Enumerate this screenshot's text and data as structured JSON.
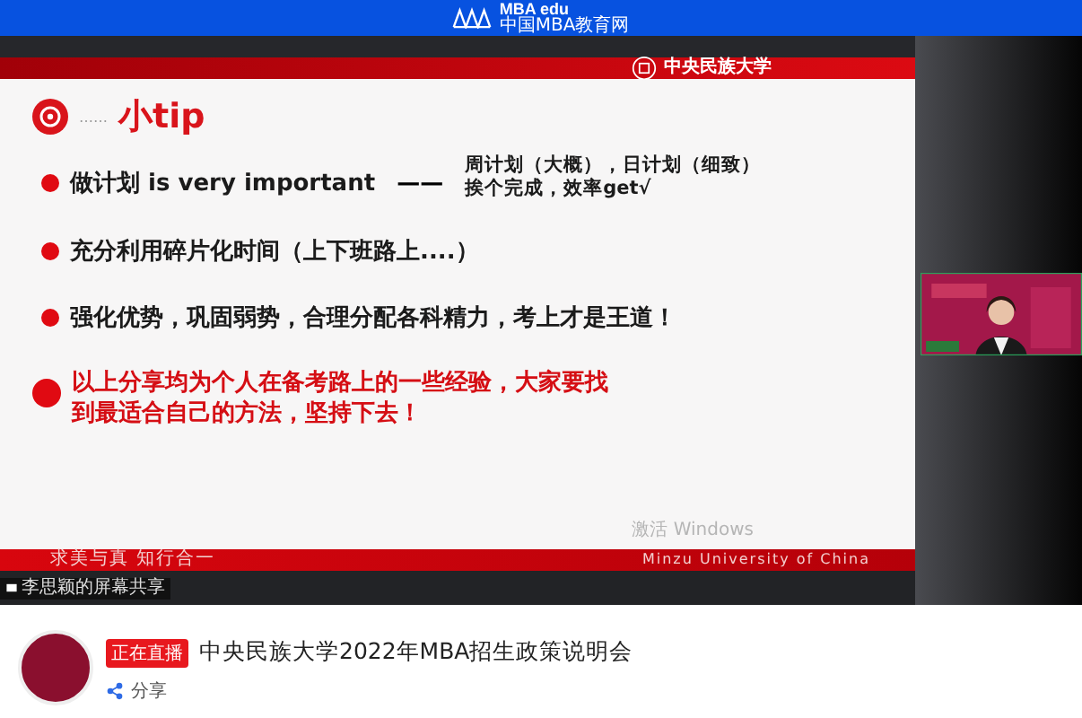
{
  "header": {
    "logo_text": "MBA edu",
    "logo_subtitle": "中国MBA教育网"
  },
  "slide": {
    "university_logo_text": "中央民族大学",
    "heading_dots": "……",
    "heading": "小tip",
    "bullets": [
      {
        "kind": "split",
        "text": "做计划 is very important",
        "dash": "——",
        "detail_lines": [
          "周计划（大概），日计划（细致）",
          "挨个完成，效率get√"
        ]
      },
      {
        "kind": "plain",
        "text": "充分利用碎片化时间（上下班路上....）"
      },
      {
        "kind": "plain",
        "text": "强化优势，巩固弱势，合理分配各科精力，考上才是王道！"
      },
      {
        "kind": "highlight",
        "text": "以上分享均为个人在备考路上的一些经验，大家要找到最适合自己的方法，坚持下去！"
      }
    ],
    "system_notice": "激活 Windows",
    "footer_motto": "求美与真  知行合一",
    "footer_name": "Minzu University of China"
  },
  "screen_share_label": "李思颖的屏幕共享",
  "info": {
    "live_badge": "正在直播",
    "title": "中央民族大学2022年MBA招生政策说明会",
    "share_label": "分享"
  }
}
